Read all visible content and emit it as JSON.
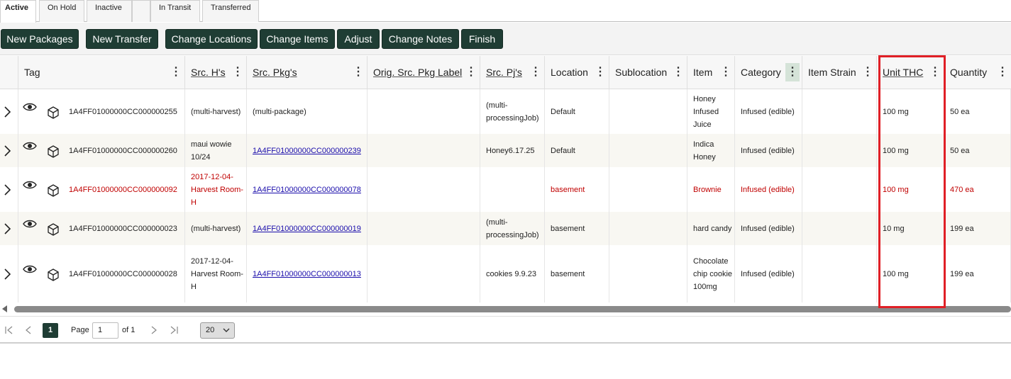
{
  "tabs": [
    {
      "label": "Active",
      "active": true
    },
    {
      "label": "On Hold",
      "active": false
    },
    {
      "label": "Inactive",
      "active": false
    },
    {
      "label": "",
      "active": false
    },
    {
      "label": "In Transit",
      "active": false
    },
    {
      "label": "Transferred",
      "active": false
    }
  ],
  "toolbar": {
    "new_packages": "New Packages",
    "new_transfer": "New Transfer",
    "change_locations": "Change Locations",
    "change_items": "Change Items",
    "adjust": "Adjust",
    "change_notes": "Change Notes",
    "finish": "Finish"
  },
  "columns": {
    "tag": "Tag",
    "src_h": "Src. H's",
    "src_pkg": "Src. Pkg's",
    "orig_src_pkg_label": "Orig. Src. Pkg Label",
    "src_pj": "Src. Pj's",
    "location": "Location",
    "sublocation": "Sublocation",
    "item": "Item",
    "category": "Category",
    "item_strain": "Item Strain",
    "unit_thc": "Unit THC",
    "quantity": "Quantity"
  },
  "rows": [
    {
      "tag": "1A4FF01000000CC000000255",
      "src_h": "(multi-harvest)",
      "src_pkg": "(multi-package)",
      "src_pkg_link": false,
      "orig_src_pkg_label": "",
      "src_pj": "(multi-processingJob)",
      "location": "Default",
      "sublocation": "",
      "item": "Honey Infused Juice",
      "category": "Infused (edible)",
      "item_strain": "",
      "unit_thc": "100 mg",
      "quantity": "50 ea",
      "flagged": false
    },
    {
      "tag": "1A4FF01000000CC000000260",
      "src_h": "maui wowie 10/24",
      "src_pkg": "1A4FF01000000CC000000239",
      "src_pkg_link": true,
      "orig_src_pkg_label": "",
      "src_pj": "Honey6.17.25",
      "location": "Default",
      "sublocation": "",
      "item": "Indica Honey",
      "category": "Infused (edible)",
      "item_strain": "",
      "unit_thc": "100 mg",
      "quantity": "50 ea",
      "flagged": false
    },
    {
      "tag": "1A4FF01000000CC000000092",
      "src_h": "2017-12-04-Harvest Room-H",
      "src_pkg": "1A4FF01000000CC000000078",
      "src_pkg_link": true,
      "orig_src_pkg_label": "",
      "src_pj": "",
      "location": "basement",
      "sublocation": "",
      "item": "Brownie",
      "category": "Infused (edible)",
      "item_strain": "",
      "unit_thc": "100 mg",
      "quantity": "470 ea",
      "flagged": true
    },
    {
      "tag": "1A4FF01000000CC000000023",
      "src_h": "(multi-harvest)",
      "src_pkg": "1A4FF01000000CC000000019",
      "src_pkg_link": true,
      "orig_src_pkg_label": "",
      "src_pj": "(multi-processingJob)",
      "location": "basement",
      "sublocation": "",
      "item": "hard candy",
      "category": "Infused (edible)",
      "item_strain": "",
      "unit_thc": "10 mg",
      "quantity": "199 ea",
      "flagged": false
    },
    {
      "tag": "1A4FF01000000CC000000028",
      "src_h": "2017-12-04-Harvest Room-H",
      "src_pkg": "1A4FF01000000CC000000013",
      "src_pkg_link": true,
      "orig_src_pkg_label": "",
      "src_pj": "cookies 9.9.23",
      "location": "basement",
      "sublocation": "",
      "item": "Chocolate chip cookie 100mg",
      "category": "Infused (edible)",
      "item_strain": "",
      "unit_thc": "100 mg",
      "quantity": "199 ea",
      "flagged": false
    }
  ],
  "pager": {
    "current_page": "1",
    "page_label": "Page",
    "page_input": "1",
    "of_label": "of 1",
    "page_size": "20"
  },
  "colors": {
    "button_bg": "#1f3d34",
    "flagged_text": "#c00000",
    "link": "#1a0dab",
    "highlight_border": "#e01f26"
  },
  "icons": [
    "chevron-right-icon",
    "eye-icon",
    "package-icon",
    "kebab-menu-icon",
    "first-page-icon",
    "prev-page-icon",
    "next-page-icon",
    "last-page-icon",
    "chevron-down-icon"
  ]
}
